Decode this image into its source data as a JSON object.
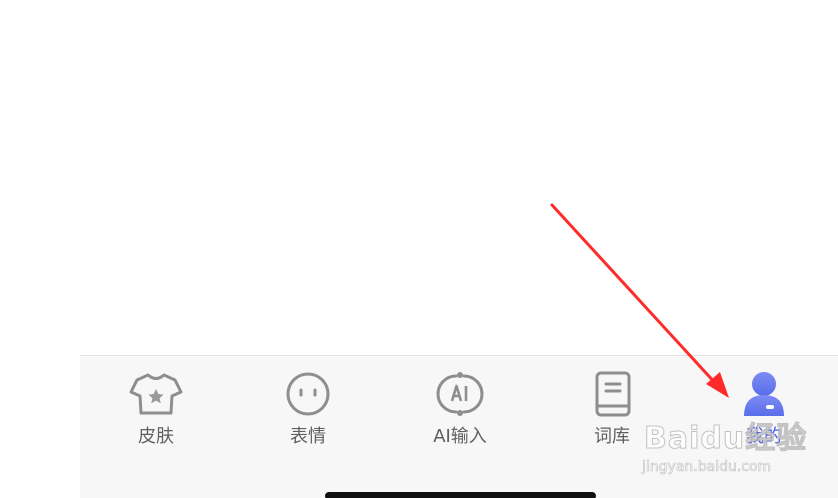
{
  "tabs": [
    {
      "label": "皮肤",
      "icon": "tshirt-star-icon",
      "active": false
    },
    {
      "label": "表情",
      "icon": "emoji-face-icon",
      "active": false
    },
    {
      "label": "AI输入",
      "icon": "ai-input-icon",
      "active": false
    },
    {
      "label": "词库",
      "icon": "book-icon",
      "active": false
    },
    {
      "label": "我的",
      "icon": "user-profile-icon",
      "active": true
    }
  ],
  "colors": {
    "active": "#4b62ee",
    "inactive_icon": "#8e8e8e",
    "inactive_label": "#5f5f5f",
    "tabbar_bg": "#f7f7f7",
    "annotation_arrow": "#ff2a2a"
  },
  "watermark": {
    "logo": "Baidu经验",
    "url": "jingyan.baidu.com"
  }
}
